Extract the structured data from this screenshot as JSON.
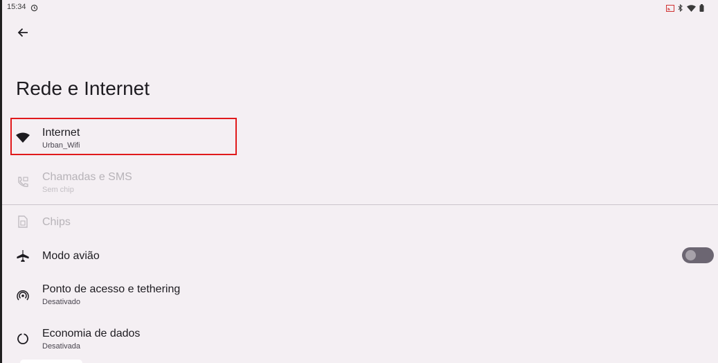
{
  "status_bar": {
    "time": "15:34"
  },
  "page": {
    "title": "Rede e Internet"
  },
  "items": [
    {
      "title": "Internet",
      "summary": "Urban_Wifi",
      "icon": "wifi-icon",
      "enabled": true
    },
    {
      "title": "Chamadas e SMS",
      "summary": "Sem chip",
      "icon": "calls-sms-icon",
      "enabled": false
    },
    {
      "title": "Chips",
      "summary": "",
      "icon": "sim-card-icon",
      "enabled": false
    },
    {
      "title": "Modo avião",
      "summary": "",
      "icon": "airplane-icon",
      "enabled": true,
      "toggle": false
    },
    {
      "title": "Ponto de acesso e tethering",
      "summary": "Desativado",
      "icon": "hotspot-icon",
      "enabled": true
    },
    {
      "title": "Economia de dados",
      "summary": "Desativada",
      "icon": "data-saver-icon",
      "enabled": true
    }
  ],
  "colors": {
    "background": "#f4eff3",
    "highlight": "#e0191b",
    "text_primary": "#1d1b20",
    "text_secondary": "#49454f",
    "text_disabled": "#b7b3b8"
  }
}
